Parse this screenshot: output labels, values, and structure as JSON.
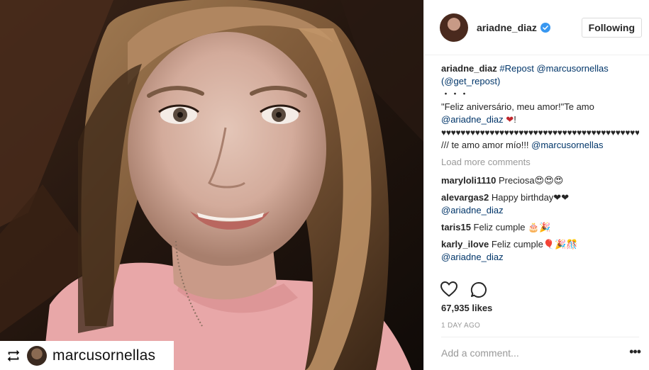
{
  "post": {
    "repost_name": "marcusornellas"
  },
  "header": {
    "username": "ariadne_diaz",
    "follow_label": "Following"
  },
  "caption": {
    "user": "ariadne_diaz",
    "repost_tag": "#Repost",
    "mention": "@marcusornellas",
    "get_repost": "(@get_repost)",
    "dots": "・・・",
    "text1": "\"Feliz aniversário, meu amor!\"Te amo",
    "mention2": "@ariadne_diaz",
    "heart_end": "❤",
    "exclaim": "!",
    "hearts": "♥♥♥♥♥♥♥♥♥♥♥♥♥♥♥♥♥♥♥♥♥♥♥♥♥♥♥♥♥♥♥♥♥♥♥♥♥♥♥♥♥♥♥♥♥♥♥♥♥♥♥♥♥",
    "text2": " /// te amo amor mío!!! ",
    "mention3": "@marcusornellas"
  },
  "load_more": "Load more comments",
  "comments": [
    {
      "user": "maryloli1110",
      "text": "Preciosa😍😍😍",
      "mention": ""
    },
    {
      "user": "alevargas2",
      "text": "Happy birthday❤❤",
      "mention": "@ariadne_diaz"
    },
    {
      "user": "taris15",
      "text": "Feliz cumple 🎂🎉",
      "mention": ""
    },
    {
      "user": "karly_ilove",
      "text": "Feliz cumple🎈🎉🎊",
      "mention": "@ariadne_diaz"
    }
  ],
  "likes": "67,935 likes",
  "timestamp": "1 DAY AGO",
  "add_comment_placeholder": "Add a comment...",
  "more_options": "•••",
  "colors": {
    "link": "#003569",
    "muted": "#999999",
    "verified": "#3897f0",
    "heart": "#ed4956"
  }
}
